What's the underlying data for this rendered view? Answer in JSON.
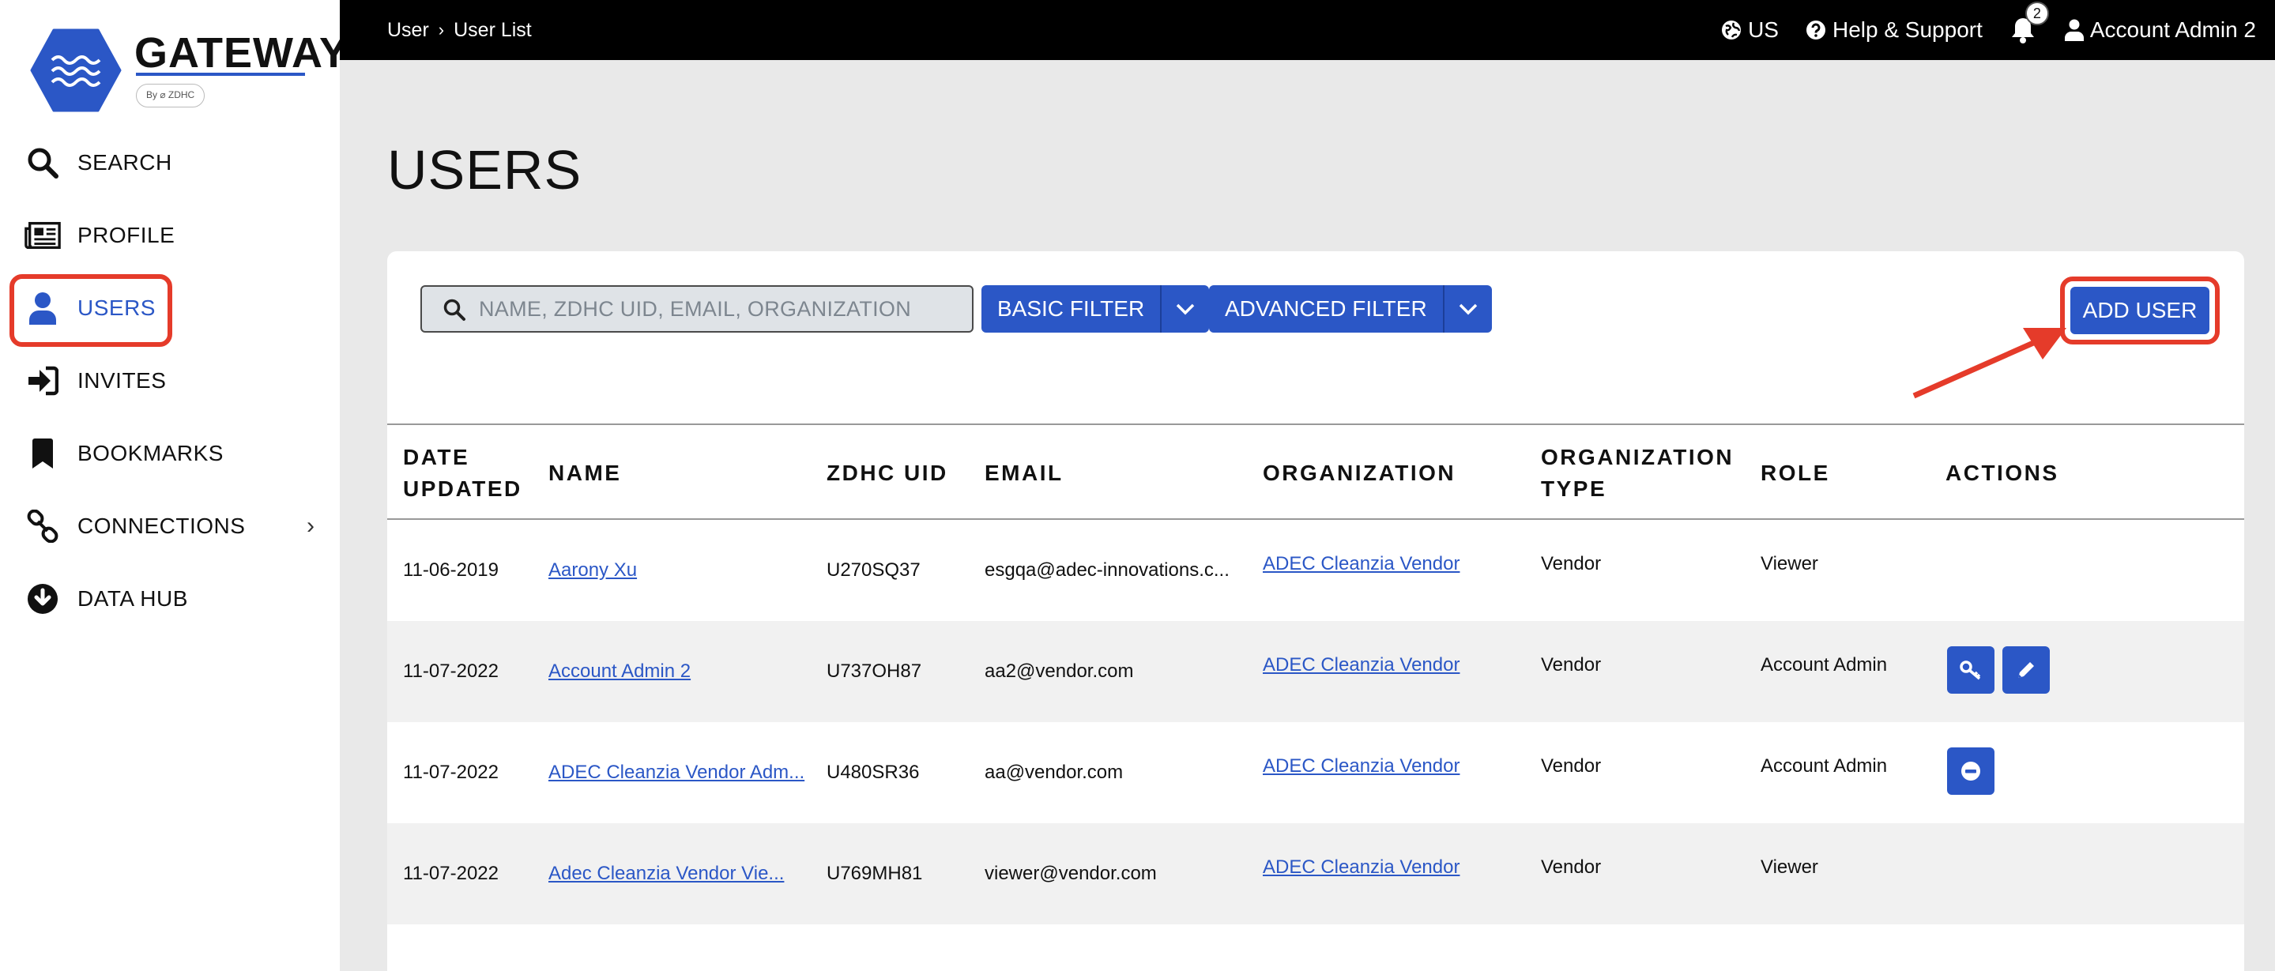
{
  "app": {
    "logo_word": "GATEWAY",
    "logo_sub": "By ⌀ ZDHC"
  },
  "sidebar": {
    "items": [
      {
        "label": "SEARCH",
        "icon": "search-icon"
      },
      {
        "label": "PROFILE",
        "icon": "newspaper-icon"
      },
      {
        "label": "USERS",
        "icon": "user-icon",
        "active": true
      },
      {
        "label": "INVITES",
        "icon": "sign-in-icon"
      },
      {
        "label": "BOOKMARKS",
        "icon": "bookmark-icon"
      },
      {
        "label": "CONNECTIONS",
        "icon": "link-icon",
        "chevron": "›"
      },
      {
        "label": "DATA HUB",
        "icon": "download-circle-icon"
      }
    ]
  },
  "topbar": {
    "breadcrumb": [
      "User",
      "User List"
    ],
    "breadcrumb_sep": "›",
    "language": "US",
    "help": "Help & Support",
    "notification_count": "2",
    "account": "Account Admin 2"
  },
  "main": {
    "title": "USERS",
    "search_placeholder": "NAME, ZDHC UID, EMAIL, ORGANIZATION",
    "basic_filter": "BASIC FILTER",
    "advanced_filter": "ADVANCED FILTER",
    "add_user": "ADD USER"
  },
  "table": {
    "headers": {
      "date_updated_1": "DATE",
      "date_updated_2": "UPDATED",
      "name": "NAME",
      "zdhc_uid": "ZDHC UID",
      "email": "EMAIL",
      "organization": "ORGANIZATION",
      "org_type_1": "ORGANIZATION",
      "org_type_2": "TYPE",
      "role": "ROLE",
      "actions": "ACTIONS"
    },
    "rows": [
      {
        "date": "11-06-2019",
        "name": "Aarony Xu",
        "uid": "U270SQ37",
        "email": "esgqa@adec-innovations.c...",
        "organization": "ADEC Cleanzia Vendor",
        "type": "Vendor",
        "role": "Viewer"
      },
      {
        "date": "11-07-2022",
        "name": "Account Admin 2",
        "uid": "U737OH87",
        "email": "aa2@vendor.com",
        "organization": "ADEC Cleanzia Vendor",
        "type": "Vendor",
        "role": "Account Admin"
      },
      {
        "date": "11-07-2022",
        "name": "ADEC Cleanzia Vendor Adm...",
        "uid": "U480SR36",
        "email": "aa@vendor.com",
        "organization": "ADEC Cleanzia Vendor",
        "type": "Vendor",
        "role": "Account Admin"
      },
      {
        "date": "11-07-2022",
        "name": "Adec Cleanzia Vendor Vie...",
        "uid": "U769MH81",
        "email": "viewer@vendor.com",
        "organization": "ADEC Cleanzia Vendor",
        "type": "Vendor",
        "role": "Viewer"
      }
    ]
  },
  "colors": {
    "brand_blue": "#2b57c6",
    "annotation_red": "#e53b2a",
    "topbar": "#000000"
  }
}
